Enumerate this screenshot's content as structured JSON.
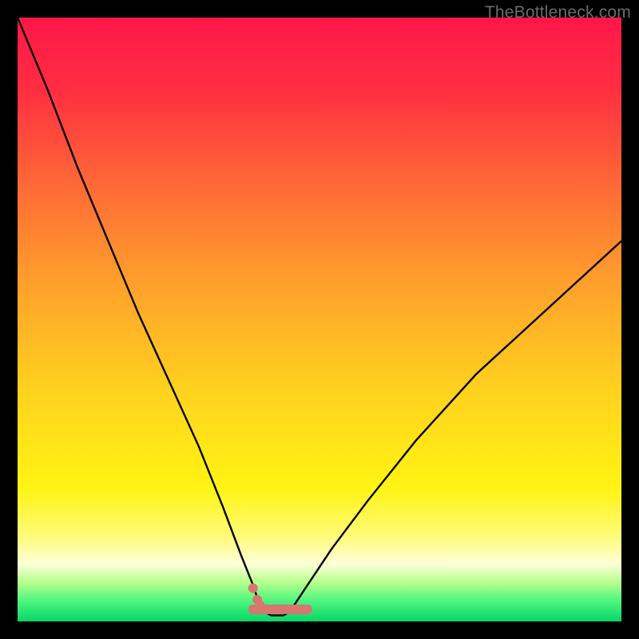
{
  "attribution": "TheBottleneck.com",
  "gradient_stops": [
    {
      "offset": 0.0,
      "color": "#ff1749"
    },
    {
      "offset": 0.12,
      "color": "#ff2e41"
    },
    {
      "offset": 0.28,
      "color": "#ff6a36"
    },
    {
      "offset": 0.45,
      "color": "#ffa32b"
    },
    {
      "offset": 0.62,
      "color": "#ffd21e"
    },
    {
      "offset": 0.78,
      "color": "#fff413"
    },
    {
      "offset": 0.86,
      "color": "#fffb7a"
    },
    {
      "offset": 0.905,
      "color": "#fdffd9"
    },
    {
      "offset": 0.935,
      "color": "#b8ff8d"
    },
    {
      "offset": 0.965,
      "color": "#51f67f"
    },
    {
      "offset": 1.0,
      "color": "#07d66a"
    }
  ],
  "chart_data": {
    "type": "line",
    "title": "",
    "xlabel": "",
    "ylabel": "",
    "xlim": [
      0,
      100
    ],
    "ylim": [
      0,
      100
    ],
    "x": [
      0,
      5,
      10,
      15,
      20,
      25,
      30,
      34,
      37,
      39,
      40,
      41,
      42,
      43,
      44,
      45,
      46,
      48,
      52,
      58,
      66,
      76,
      88,
      100
    ],
    "series": [
      {
        "name": "bottleneck-curve",
        "values": [
          100,
          88,
          75,
          63,
          51,
          40,
          29,
          19,
          11,
          6,
          3,
          1.5,
          1,
          1,
          1,
          1.5,
          3,
          6,
          12,
          20,
          30,
          41,
          52,
          63
        ]
      }
    ],
    "flat_segment": {
      "x_start": 39,
      "x_end": 48,
      "y": 2
    },
    "markers": [
      {
        "x": 39.0,
        "y": 5.5
      },
      {
        "x": 39.7,
        "y": 3.6
      },
      {
        "x": 40.2,
        "y": 2.6
      }
    ],
    "curve_stroke": "#000000",
    "flat_stroke": "#d8766f",
    "marker_fill": "#d8766f"
  }
}
